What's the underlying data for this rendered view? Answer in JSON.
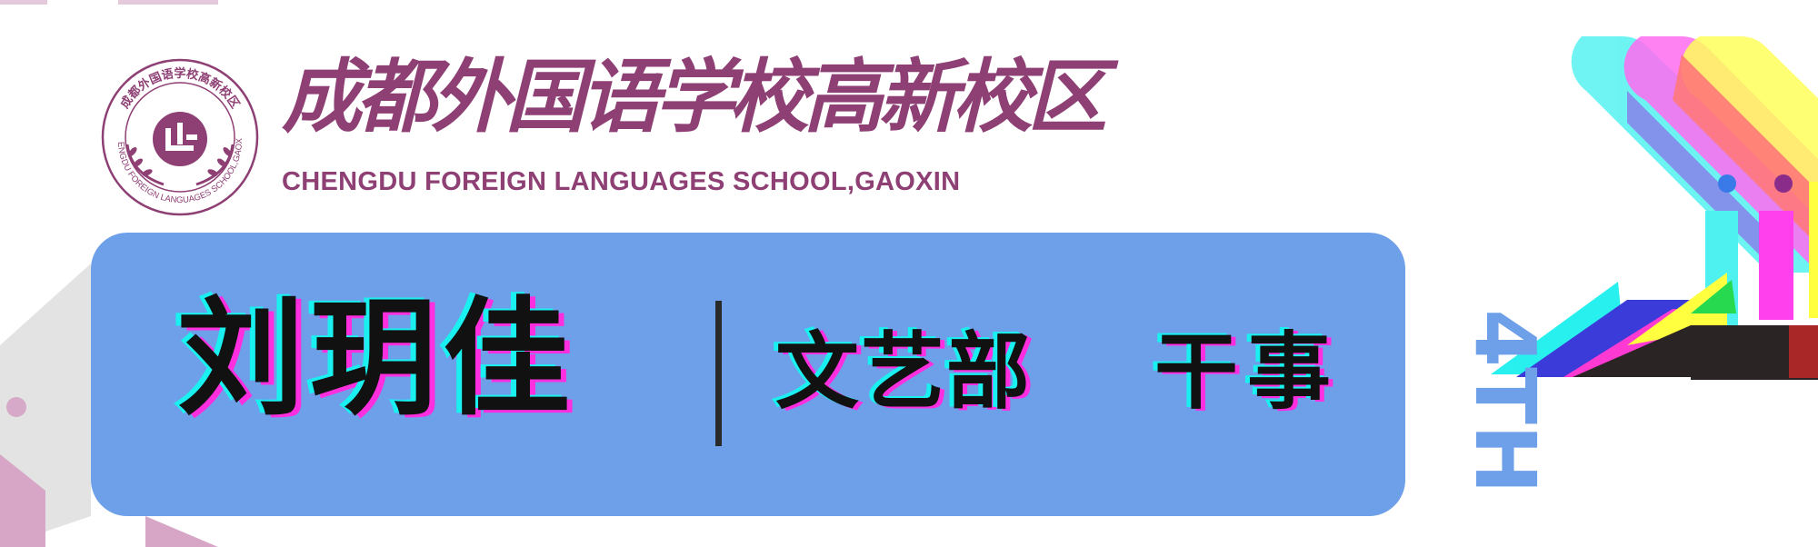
{
  "header": {
    "school_name_cn": "成都外国语学校高新校区",
    "school_name_en": "CHENGDU FOREIGN LANGUAGES SCHOOL,GAOXIN",
    "logo_icon": "school-emblem-icon"
  },
  "card": {
    "person_name": "刘玥佳",
    "department": "文艺部",
    "role": "干事",
    "side_label": "4TH"
  },
  "colors": {
    "brand_purple": "#8e3f74",
    "card_blue": "#6ea0ea",
    "glitch_cyan": "#19f0ef",
    "glitch_magenta": "#ff2fe0",
    "glitch_yellow": "#ffff30",
    "text_dark": "#111111"
  }
}
